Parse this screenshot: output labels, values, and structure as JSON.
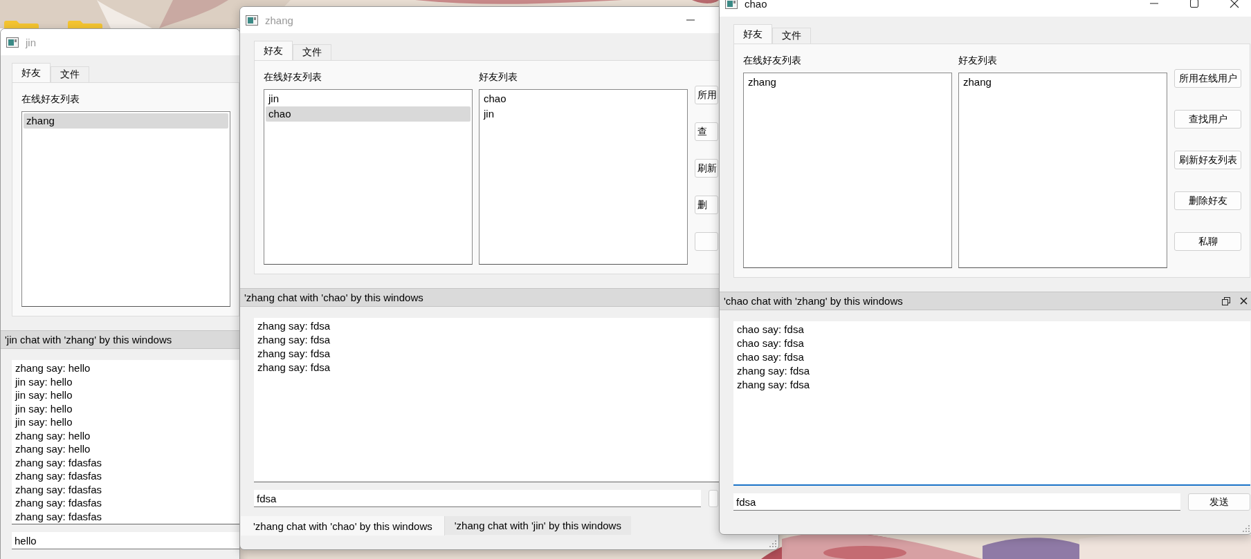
{
  "windows": [
    {
      "title": "jin",
      "active": false,
      "tabs": [
        {
          "label": "好友",
          "selected": true
        },
        {
          "label": "文件",
          "selected": false
        }
      ],
      "online_label": "在线好友列表",
      "online_list": [
        {
          "name": "zhang",
          "selected": true
        }
      ],
      "dock_title": "'jin chat with 'zhang' by this windows",
      "chat_log": {
        "focused": false,
        "lines": [
          "zhang say: hello",
          "jin say: hello",
          "jin say: hello",
          "jin say: hello",
          "jin say: hello",
          "zhang say: hello",
          "zhang say: hello",
          "zhang say: fdasfas",
          "zhang say: fdasfas",
          "zhang say: fdasfas",
          "zhang say: fdasfas",
          "zhang say: fdasfas"
        ]
      },
      "message_input": {
        "value": "hello"
      }
    },
    {
      "title": "zhang",
      "active": false,
      "controls": [
        {
          "kind": "minimize"
        }
      ],
      "tabs": [
        {
          "label": "好友",
          "selected": true
        },
        {
          "label": "文件",
          "selected": false
        }
      ],
      "online_label": "在线好友列表",
      "online_list": [
        {
          "name": "jin",
          "selected": false
        },
        {
          "name": "chao",
          "selected": true
        }
      ],
      "friends_label": "好友列表",
      "friends_list": [
        {
          "name": "chao",
          "selected": false
        },
        {
          "name": "jin",
          "selected": false
        }
      ],
      "buttons": [
        {
          "kind": "button",
          "label": "所用"
        },
        {
          "kind": "button",
          "label": "查"
        },
        {
          "kind": "button",
          "label": "刷新"
        },
        {
          "kind": "button",
          "label": "删"
        },
        {
          "kind": "button"
        }
      ],
      "dock_title": "'zhang chat with 'chao' by this windows",
      "chat_log": {
        "focused": false,
        "lines": [
          "zhang say: fdsa",
          "zhang say: fdsa",
          "zhang say: fdsa",
          "zhang say: fdsa"
        ]
      },
      "message_input": {
        "value": "fdsa"
      },
      "send_button": {
        "kind": "button"
      },
      "chat_tabs": [
        {
          "label": "'zhang chat with 'chao' by this windows",
          "selected": true
        },
        {
          "label": "'zhang chat with 'jin' by this windows",
          "selected": false
        }
      ]
    },
    {
      "title": "chao",
      "active": true,
      "controls": [
        {
          "kind": "minimize"
        },
        {
          "kind": "maximize"
        },
        {
          "kind": "close"
        }
      ],
      "tabs": [
        {
          "label": "好友",
          "selected": true
        },
        {
          "label": "文件",
          "selected": false
        }
      ],
      "online_label": "在线好友列表",
      "online_list": [
        {
          "name": "zhang",
          "selected": false
        }
      ],
      "friends_label": "好友列表",
      "friends_list": [
        {
          "name": "zhang",
          "selected": false
        }
      ],
      "buttons": [
        {
          "kind": "button",
          "label": "所用在线用户"
        },
        {
          "kind": "button",
          "label": "查找用户"
        },
        {
          "kind": "button",
          "label": "刷新好友列表"
        },
        {
          "kind": "button",
          "label": "删除好友"
        },
        {
          "kind": "button",
          "label": "私聊"
        }
      ],
      "dock_title": "'chao chat with 'zhang' by this windows",
      "dock_controls": [
        {
          "kind": "float"
        },
        {
          "kind": "close"
        }
      ],
      "chat_log": {
        "focused": true,
        "lines": [
          "chao say: fdsa",
          "chao say: fdsa",
          "chao say: fdsa",
          "zhang say: fdsa",
          "zhang say: fdsa"
        ]
      },
      "message_input": {
        "value": "fdsa"
      },
      "send_button": {
        "kind": "button",
        "label": "发送"
      }
    }
  ]
}
